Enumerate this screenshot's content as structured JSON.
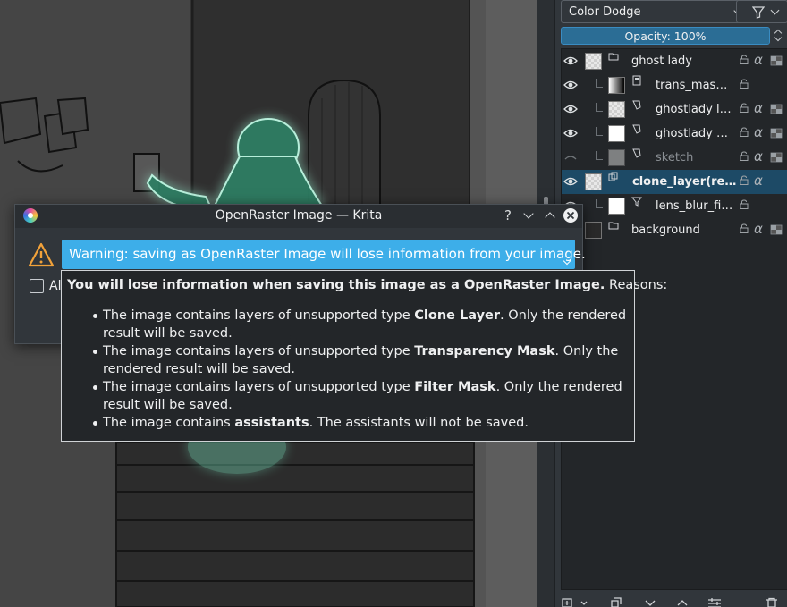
{
  "layers_panel": {
    "blend_mode": "Color Dodge",
    "opacity_label": "Opacity:  100%",
    "opacity_percent": 100,
    "layers": [
      {
        "name": "ghost lady",
        "thumb": "checker",
        "type_icon": "group-layer-icon",
        "visible": true,
        "child": false,
        "selected": false,
        "dim": false,
        "show_alpha": true,
        "show_inherit": true
      },
      {
        "name": "trans_mas…",
        "thumb": "gradient",
        "type_icon": "transparency-mask-icon",
        "visible": true,
        "child": true,
        "selected": false,
        "dim": false,
        "show_alpha": false,
        "show_inherit": false
      },
      {
        "name": "ghostlady l…",
        "thumb": "checker",
        "type_icon": "paint-layer-icon",
        "visible": true,
        "child": true,
        "selected": false,
        "dim": false,
        "show_alpha": true,
        "show_inherit": true
      },
      {
        "name": "ghostlady …",
        "thumb": "white",
        "type_icon": "paint-layer-icon",
        "visible": true,
        "child": true,
        "selected": false,
        "dim": false,
        "show_alpha": true,
        "show_inherit": true
      },
      {
        "name": "sketch",
        "thumb": "sketchy",
        "type_icon": "paint-layer-icon",
        "visible": false,
        "child": true,
        "selected": false,
        "dim": true,
        "show_alpha": true,
        "show_inherit": true
      },
      {
        "name": "clone_layer(re…",
        "thumb": "checker",
        "type_icon": "clone-layer-icon",
        "visible": true,
        "child": false,
        "selected": true,
        "dim": false,
        "show_alpha": true,
        "show_inherit": false
      },
      {
        "name": "lens_blur_fi…",
        "thumb": "white",
        "type_icon": "filter-mask-icon",
        "visible": true,
        "child": true,
        "selected": false,
        "dim": false,
        "show_alpha": false,
        "show_inherit": false
      },
      {
        "name": "background",
        "thumb": "dark",
        "type_icon": "group-layer-icon",
        "visible": true,
        "child": false,
        "selected": false,
        "dim": false,
        "show_alpha": true,
        "show_inherit": true
      }
    ]
  },
  "dialog": {
    "title": "OpenRaster Image — Krita",
    "help_glyph": "?",
    "warning_text": "Warning: saving as OpenRaster Image will lose information from your image.",
    "checkbox_label": "Al"
  },
  "tooltip": {
    "header_bold": "You will lose information when saving this image as a OpenRaster Image.",
    "header_rest": " Reasons:",
    "reasons": [
      {
        "pre": "The image contains layers of unsupported type ",
        "bold": "Clone Layer",
        "post": ". Only the rendered result will be saved."
      },
      {
        "pre": "The image contains layers of unsupported type ",
        "bold": "Transparency Mask",
        "post": ". Only the rendered result will be saved."
      },
      {
        "pre": "The image contains layers of unsupported type ",
        "bold": "Filter Mask",
        "post": ". Only the rendered result will be saved."
      },
      {
        "pre": "The image contains ",
        "bold": "assistants",
        "post": ". The assistants will not be saved."
      }
    ]
  },
  "colors": {
    "accent": "#3daee9",
    "selection": "#1d4a66",
    "panel_bg": "#31363b",
    "list_bg": "#232629",
    "ghost_glow": "#7ff0c8"
  }
}
